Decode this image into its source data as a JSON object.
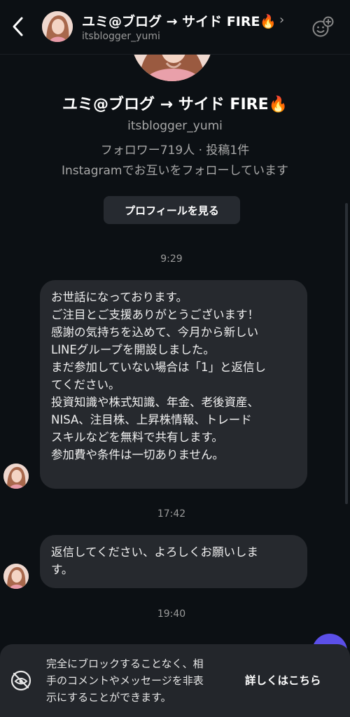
{
  "header": {
    "name": "ユミ@ブログ → サイド FIRE🔥",
    "username": "itsblogger_yumi",
    "chevron": "›",
    "icons": {
      "back": "back-arrow-icon",
      "action": "effects-icon"
    }
  },
  "profile": {
    "name": "ユミ@ブログ → サイド FIRE🔥",
    "username": "itsblogger_yumi",
    "stats": "フォロワー719人 · 投稿1件",
    "mutual": "Instagramでお互いをフォローしています",
    "view_profile_button": "プロフィールを見る"
  },
  "messages": [
    {
      "timestamp": "9:29",
      "lines": [
        "お世話になっております。",
        "ご注目とご支援ありがとうございます！",
        "感謝の気持ちを込めて、今月から新しい",
        "LINEグループを開設しました。",
        "まだ参加していない場合は「1」と返信し",
        "てください。",
        "投資知識や株式知識、年金、老後資産、",
        "NISA、注目株、上昇株情報、トレード",
        "スキルなどを無料で共有します。",
        "参加費や条件は一切ありません。"
      ]
    },
    {
      "timestamp": "17:42",
      "lines": [
        "返信してください、よろしくお願いしま",
        "す。"
      ]
    },
    {
      "timestamp": "19:40",
      "lines": []
    }
  ],
  "banner": {
    "text_lines": [
      "完全にブロックすることなく、相",
      "手のコメントやメッセージを非表",
      "示にすることができます。"
    ],
    "link": "詳しくはこちら",
    "icon": "hidden-eye-icon"
  },
  "colors": {
    "background": "#0c1014",
    "bubble": "#26292e",
    "accent": "#5b4fe8"
  }
}
